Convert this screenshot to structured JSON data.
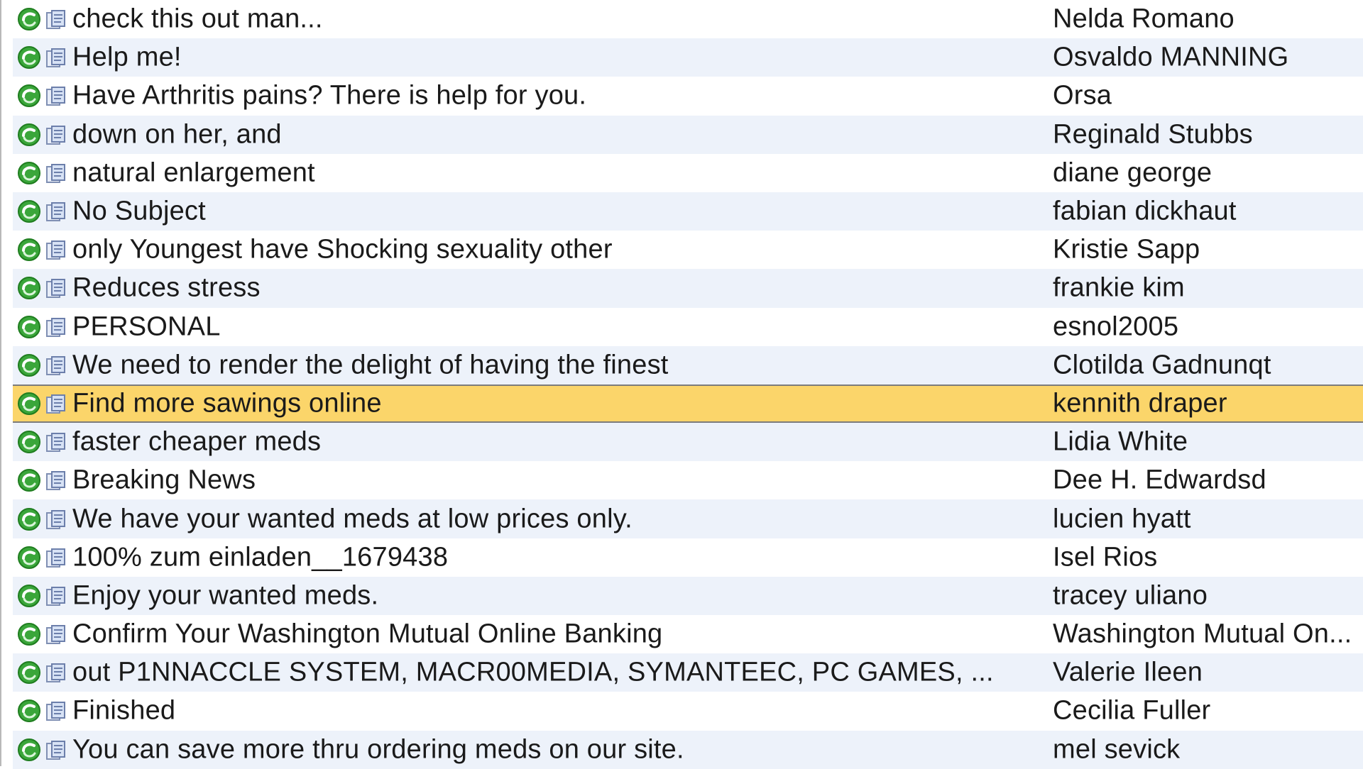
{
  "message_list": {
    "status_icon_name": "mail-status-icon",
    "attachment_icon_name": "document-icon",
    "colors": {
      "row_odd": "#ffffff",
      "row_even": "#edf2fa",
      "row_selected": "#fbd56a",
      "status_icon": "#3aa63a"
    },
    "selected_index": 10,
    "rows": [
      {
        "subject": "check this out man...",
        "sender": "Nelda Romano"
      },
      {
        "subject": "Help me!",
        "sender": "Osvaldo MANNING"
      },
      {
        "subject": "Have Arthritis pains? There is help for you.",
        "sender": "Orsa"
      },
      {
        "subject": "down on her, and",
        "sender": "Reginald Stubbs"
      },
      {
        "subject": "natural enlargement",
        "sender": "diane george"
      },
      {
        "subject": "No Subject",
        "sender": "fabian dickhaut"
      },
      {
        "subject": "only Youngest have Shocking sexuality other",
        "sender": "Kristie Sapp"
      },
      {
        "subject": "Reduces stress",
        "sender": "frankie kim"
      },
      {
        "subject": "PERSONAL",
        "sender": "esnol2005"
      },
      {
        "subject": "We need to render the delight of having the finest",
        "sender": "Clotilda Gadnunqt"
      },
      {
        "subject": "Find more sawings online",
        "sender": "kennith draper"
      },
      {
        "subject": "faster cheaper meds",
        "sender": "Lidia White"
      },
      {
        "subject": "Breaking News",
        "sender": "Dee H. Edwardsd"
      },
      {
        "subject": "We have your wanted meds at low prices only.",
        "sender": "lucien hyatt"
      },
      {
        "subject": "100% zum einladen__1679438",
        "sender": "Isel Rios"
      },
      {
        "subject": "Enjoy your wanted meds.",
        "sender": "tracey uliano"
      },
      {
        "subject": "Confirm Your Washington Mutual Online Banking",
        "sender": "Washington Mutual On..."
      },
      {
        "subject": "out P1NNACCLE SYSTEM, MACR00MEDIA, SYMANTEEC, PC GAMES, ...",
        "sender": "Valerie Ileen"
      },
      {
        "subject": "Finished",
        "sender": "Cecilia Fuller"
      },
      {
        "subject": "You can save more thru ordering meds on our site.",
        "sender": "mel sevick"
      }
    ]
  }
}
